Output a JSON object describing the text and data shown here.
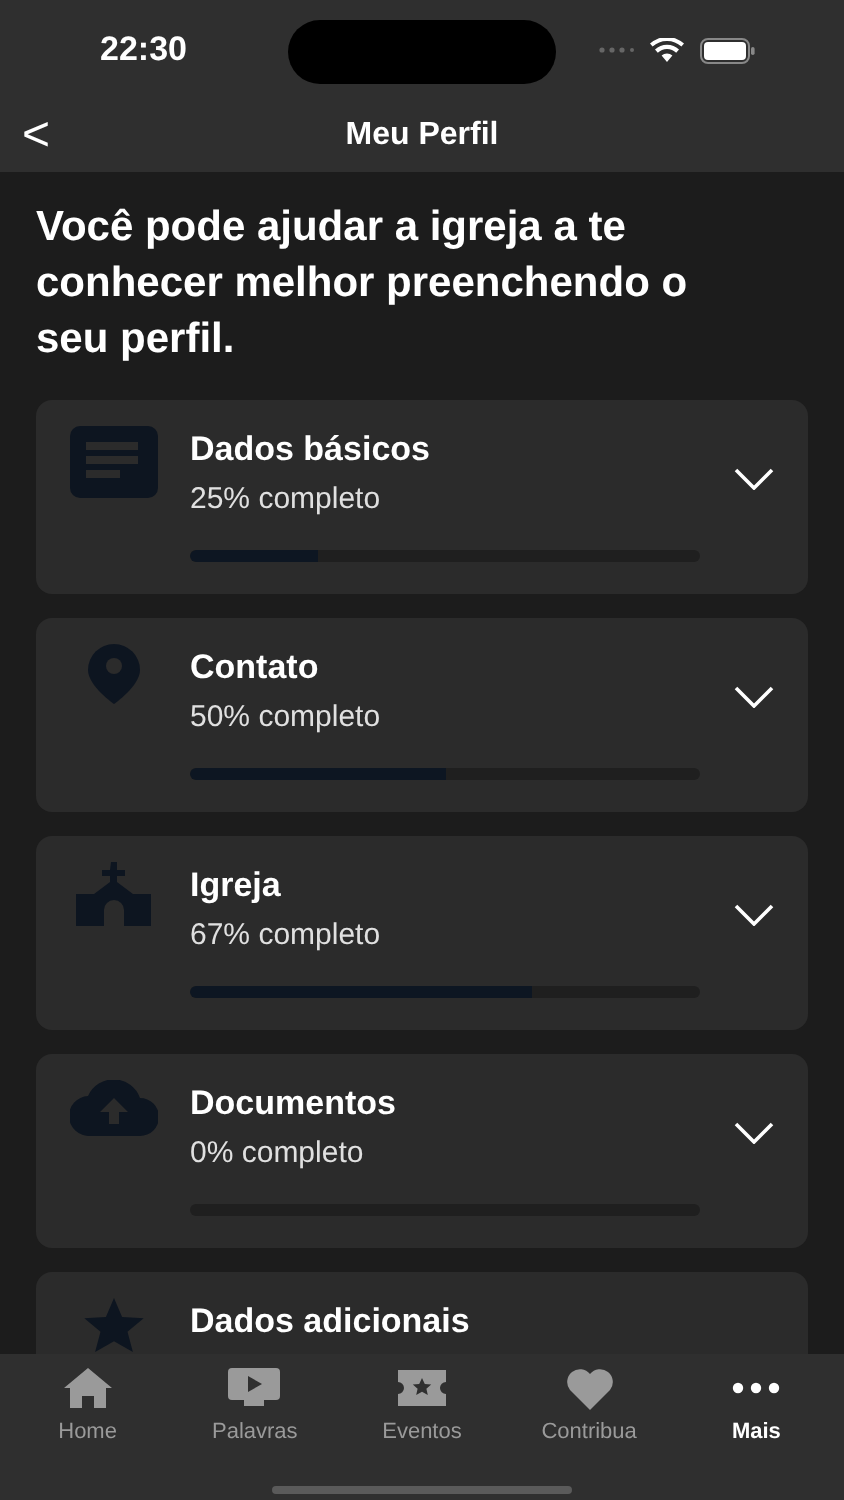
{
  "status_bar": {
    "time": "22:30"
  },
  "nav": {
    "back": "<",
    "title": "Meu Perfil"
  },
  "intro": "Você pode ajudar a igreja a te conhecer melhor preenchendo o seu perfil.",
  "sections": [
    {
      "kind": "document",
      "title": "Dados básicos",
      "progress": "25% completo",
      "level": 0.25
    },
    {
      "kind": "pin",
      "title": "Contato",
      "progress": "50% completo",
      "level": 0.5
    },
    {
      "kind": "church",
      "title": "Igreja",
      "progress": "67% completo",
      "level": 0.67
    },
    {
      "kind": "cloud-upload",
      "title": "Documentos",
      "progress": "0% completo",
      "level": 0
    },
    {
      "kind": "star",
      "title": "Dados adicionais"
    }
  ],
  "tabs": [
    {
      "kind": "home",
      "label": "Home",
      "selected": false
    },
    {
      "kind": "play",
      "label": "Palavras",
      "selected": false
    },
    {
      "kind": "ticket",
      "label": "Eventos",
      "selected": false
    },
    {
      "kind": "heart",
      "label": "Contribua",
      "selected": false
    },
    {
      "kind": "more",
      "label": "Mais",
      "selected": true
    }
  ]
}
